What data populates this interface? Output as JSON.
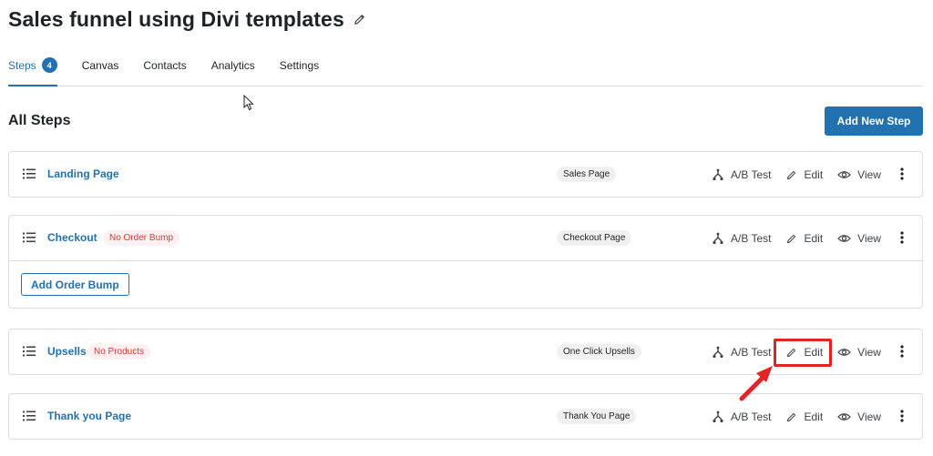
{
  "page": {
    "title": "Sales funnel using Divi templates"
  },
  "tabs": [
    {
      "label": "Steps",
      "count": "4"
    },
    {
      "label": "Canvas"
    },
    {
      "label": "Contacts"
    },
    {
      "label": "Analytics"
    },
    {
      "label": "Settings"
    }
  ],
  "section": {
    "heading": "All Steps",
    "add_button": "Add New Step"
  },
  "actions": {
    "ab_test": "A/B Test",
    "edit": "Edit",
    "view": "View"
  },
  "steps": [
    {
      "name": "Landing Page",
      "type": "Sales Page"
    },
    {
      "name": "Checkout",
      "warning": "No Order Bump",
      "type": "Checkout Page",
      "extra_button": "Add Order Bump"
    },
    {
      "name": "Upsells",
      "warning": "No Products",
      "type": "One Click Upsells"
    },
    {
      "name": "Thank you Page",
      "type": "Thank You Page"
    }
  ],
  "colors": {
    "accent": "#2271b1",
    "warning": "#d63638",
    "annotation": "#e12525"
  },
  "icons": [
    "pencil-icon",
    "drag-handle-icon",
    "ab-test-icon",
    "eye-icon",
    "kebab-menu-icon",
    "mouse-cursor-icon",
    "annotation-arrow-icon"
  ]
}
